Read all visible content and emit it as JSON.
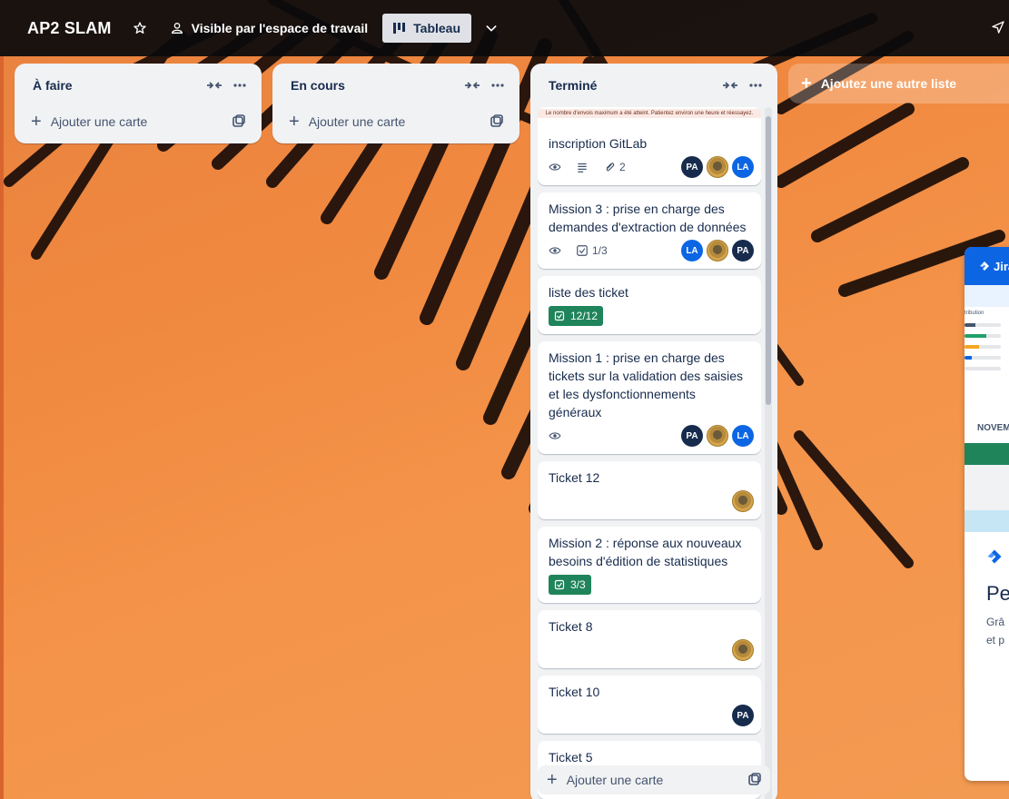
{
  "header": {
    "board_title": "AP2 SLAM",
    "visibility_label": "Visible par l'espace de travail",
    "view_label": "Tableau"
  },
  "lists": [
    {
      "title": "À faire",
      "add_card_label": "Ajouter une carte"
    },
    {
      "title": "En cours",
      "add_card_label": "Ajouter une carte"
    },
    {
      "title": "Terminé",
      "add_card_label": "Ajouter une carte"
    }
  ],
  "add_list_label": "Ajoutez une autre liste",
  "rate_limit_message": "Le nombre d'envois maximum a été atteint. Patientez environ une heure et réessayez.",
  "cards": [
    {
      "title": "inscription GitLab",
      "attachments": "2",
      "members": [
        "PA",
        "img",
        "LA"
      ]
    },
    {
      "title": "Mission 3 : prise en charge des demandes d'extraction de données",
      "checklist": "1/3",
      "members": [
        "LA",
        "img",
        "PA"
      ]
    },
    {
      "title": "liste des ticket",
      "checklist_done": "12/12",
      "members": []
    },
    {
      "title": "Mission 1 : prise en charge des tickets sur la validation des saisies et les dysfonctionnements généraux",
      "members": [
        "PA",
        "img",
        "LA"
      ]
    },
    {
      "title": "Ticket 12",
      "members": [
        "img"
      ]
    },
    {
      "title": "Mission 2 : réponse aux nouveaux besoins d'édition de statistiques",
      "checklist_done": "3/3",
      "members": []
    },
    {
      "title": "Ticket 8",
      "members": [
        "img"
      ]
    },
    {
      "title": "Ticket 10",
      "members": [
        "PA"
      ]
    },
    {
      "title": "Ticket 5",
      "members": []
    }
  ],
  "jira": {
    "header_label": "Jira",
    "chart_label": "tribution",
    "month_label": "NOVEM",
    "big_text": "Pe",
    "small_line_1": "Grâ",
    "small_line_2": "et p"
  },
  "colors": {
    "topbar": "#0a0a0c",
    "list_bg": "#f1f2f4",
    "done_badge": "#1f845a",
    "avatar_pa": "#172b4d",
    "avatar_la": "#0c66e4",
    "jira_blue": "#0c66e4"
  }
}
